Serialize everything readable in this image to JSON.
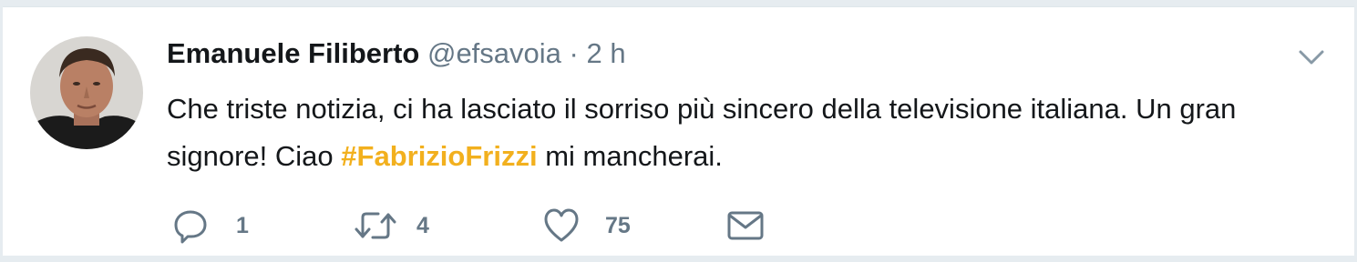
{
  "tweet": {
    "author_name": "Emanuele Filiberto",
    "handle": "@efsavoia",
    "separator": "·",
    "time": "2 h",
    "text_part1": "Che triste notizia, ci ha lasciato il sorriso più sincero della televisione italiana. Un gran signore! Ciao ",
    "hashtag": "#FabrizioFrizzi",
    "text_part2": " mi mancherai.",
    "hashtag_color": "#f2b01e"
  },
  "actions": {
    "reply_count": "1",
    "retweet_count": "4",
    "like_count": "75"
  },
  "icons": {
    "reply": "reply-icon",
    "retweet": "retweet-icon",
    "like": "heart-icon",
    "dm": "envelope-icon",
    "more": "chevron-down-icon"
  }
}
